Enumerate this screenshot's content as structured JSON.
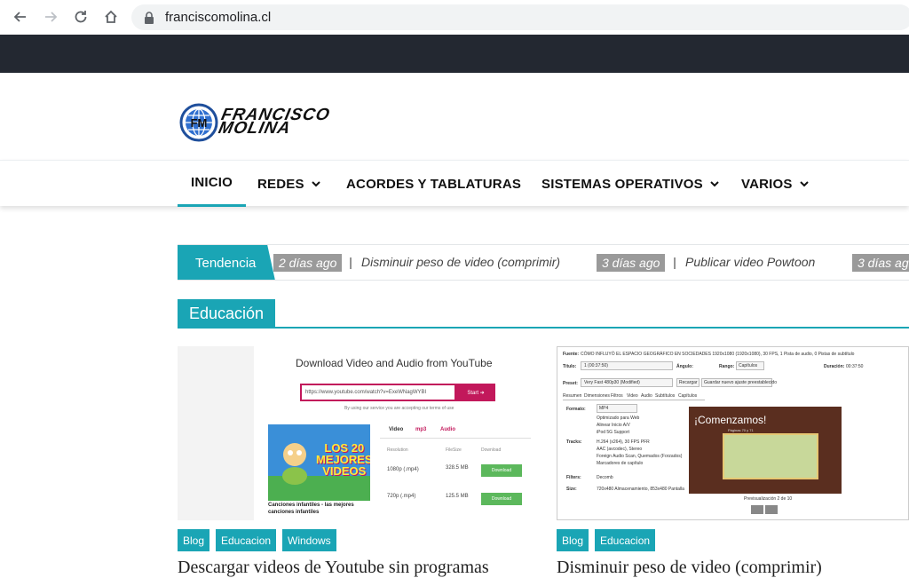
{
  "browser": {
    "url": "franciscomolina.cl"
  },
  "logo": {
    "line1": "Francisco",
    "line2": "Molina",
    "mark": "FM"
  },
  "nav": {
    "items": [
      {
        "label": "INICIO",
        "active": true,
        "has_dropdown": false
      },
      {
        "label": "REDES",
        "has_dropdown": true
      },
      {
        "label": "ACORDES Y TABLATURAS",
        "has_dropdown": false
      },
      {
        "label": "SISTEMAS OPERATIVOS",
        "has_dropdown": true
      },
      {
        "label": "VARIOS",
        "has_dropdown": true
      }
    ]
  },
  "ticker": {
    "label": "Tendencia",
    "items": [
      {
        "ago": "2 días ago",
        "title": "Disminuir peso de video (comprimir)"
      },
      {
        "ago": "3 días ago",
        "title": "Publicar video Powtoon"
      },
      {
        "ago": "3 días ag",
        "title": ""
      }
    ]
  },
  "section": {
    "title": "Educación"
  },
  "cards": [
    {
      "tags": [
        "Blog",
        "Educacion",
        "Windows"
      ],
      "title": "Descargar videos de Youtube sin programas",
      "thumb": {
        "heading": "Download Video and Audio from YouTube",
        "input_value": "https://www.youtube.com/watch?v=ExeWNagWYBI",
        "start_label": "Start ➜",
        "note": "By using our service you are accepting our terms of use",
        "video_sticker": "LOS 20 MEJORES VIDEOS",
        "video_caption": "Canciones infantiles - las mejores canciones infantiles",
        "tabs": [
          "Video",
          "mp3",
          "Audio"
        ],
        "columns": [
          "Resolution",
          "FileSize",
          "Download"
        ],
        "rows": [
          {
            "res": "1080p (.mp4)",
            "size": "328.5 MB",
            "dl": "Download"
          },
          {
            "res": "720p (.mp4)",
            "size": "125.5 MB",
            "dl": "Download"
          }
        ]
      }
    },
    {
      "tags": [
        "Blog",
        "Educacion"
      ],
      "title": "Disminuir peso de video (comprimir)",
      "thumb": {
        "source_label": "Fuente:",
        "source_value": "CÓMO INFLUYÓ EL ESPACIO GEOGRÁFICO EN SOCIEDADES  1920x1080 (1920x1080), 30 FPS, 1 Pista de audio, 0 Pistas de subtítulo",
        "title_label": "Título:",
        "title_value": "1 (00:37:50)",
        "angle_label": "Ángulo:",
        "range_label": "Rango:",
        "range_value": "Capítulos",
        "duration_label": "Duración:",
        "duration_value": "00:37:50",
        "preset_label": "Preset:",
        "preset_value": "Very Fast 480p30 (Modified)",
        "reload": "Recargar",
        "save_preset": "Guardar nuevo ajuste preestablecido",
        "tabs": [
          "Resumen",
          "Dimensiones",
          "Filtros",
          "Video",
          "Audio",
          "Subtítulos",
          "Capítulos"
        ],
        "format_label": "Formato:",
        "format_value": "MP4",
        "opts": [
          "Optimizado para Web",
          "Alinear Inicio A/V",
          "iPod 5G Support"
        ],
        "tracks_label": "Tracks:",
        "tracks": [
          "H.264 (x264), 30 FPS PFR",
          "AAC (avcodec), Stereo",
          "Foreign Audio Scan, Quemados (Forzados)",
          "Marcadores de capítulo"
        ],
        "filters_label": "Filters:",
        "filters_value": "Decomb",
        "size_label": "Size:",
        "size_value": "720x480 Almacenamiento, 853x480 Pantalla",
        "preview_heading": "¡Comenzamos!",
        "preview_sub": "Páginas 70 y 71",
        "preview_caption": "Previsualización 2 de 10"
      }
    }
  ]
}
